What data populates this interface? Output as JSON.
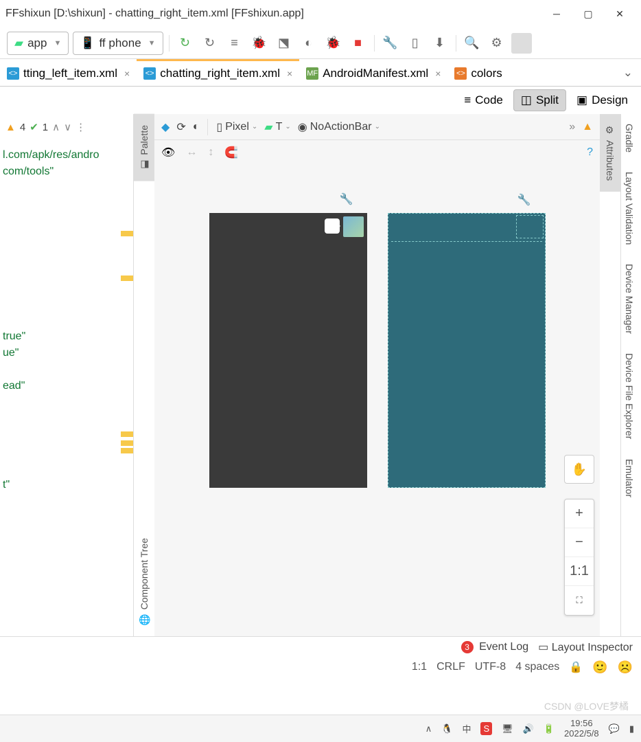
{
  "window": {
    "title": "FFshixun [D:\\shixun] - chatting_right_item.xml [FFshixun.app]"
  },
  "toolbar": {
    "module": "app",
    "device": "ff phone"
  },
  "tabs": [
    {
      "label": "tting_left_item.xml",
      "icon": "xml",
      "active": false
    },
    {
      "label": "chatting_right_item.xml",
      "icon": "xml",
      "active": true
    },
    {
      "label": "AndroidManifest.xml",
      "icon": "mf",
      "active": false
    },
    {
      "label": "colors",
      "icon": "c",
      "active": false
    }
  ],
  "viewmodes": {
    "code": "Code",
    "split": "Split",
    "design": "Design"
  },
  "code": {
    "warnings": "4",
    "checks": "1",
    "lines": [
      "l.com/apk/res/andro",
      "com/tools\"",
      "",
      "",
      "",
      "",
      "",
      "true\"",
      "ue\"",
      "",
      "ead\"",
      "",
      "",
      "",
      "t\""
    ]
  },
  "design_toolbar": {
    "device": "Pixel",
    "api": "T",
    "theme": "NoActionBar"
  },
  "side_panels": {
    "palette": "Palette",
    "component_tree": "Component Tree",
    "attributes": "Attributes",
    "gradle": "Gradle",
    "layout_validation": "Layout Validation",
    "device_manager": "Device Manager",
    "device_file_explorer": "Device File Explorer",
    "emulator": "Emulator"
  },
  "zoom": {
    "one_to_one": "1:1"
  },
  "status": {
    "event_log_count": "3",
    "event_log": "Event Log",
    "layout_inspector": "Layout Inspector",
    "cursor": "1:1",
    "line_sep": "CRLF",
    "encoding": "UTF-8",
    "indent": "4 spaces"
  },
  "taskbar": {
    "time": "19:56",
    "date": "2022/5/8"
  },
  "watermark": "CSDN @LOVE梦橘"
}
